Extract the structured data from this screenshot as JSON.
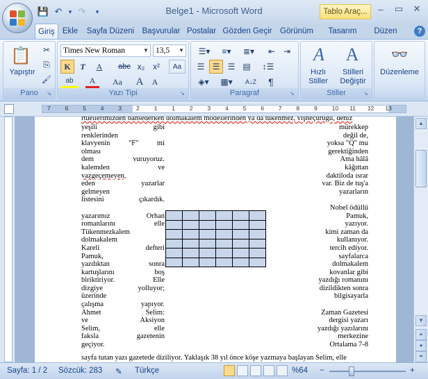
{
  "app": {
    "title": "Belge1 - Microsoft Word",
    "context_tab_title": "Tablo Araç...",
    "qat": {
      "save": "💾",
      "undo": "↶",
      "undo_dd": "▾",
      "redo": "↷",
      "custom": "▾"
    },
    "win": {
      "min": "–",
      "max": "▭",
      "close": "✕"
    }
  },
  "tabs": [
    "Giriş",
    "Ekle",
    "Sayfa Düzeni",
    "Başvurular",
    "Postalar",
    "Gözden Geçir",
    "Görünüm",
    "Tasarım",
    "Düzen"
  ],
  "ribbon": {
    "clipboard": {
      "label": "Pano",
      "paste": "Yapıştır",
      "cut": "✂",
      "copy": "⎘",
      "format": "🖌"
    },
    "font": {
      "label": "Yazı Tipi",
      "name": "Times New Roman",
      "size": "13,5",
      "bold": "K",
      "italic": "T",
      "underline": "A",
      "strike": "abc",
      "sub": "x₂",
      "sup": "x²",
      "clear": "Aa",
      "grow": "A",
      "shrink": "A",
      "case": "Aa",
      "highlight": "ab",
      "color": "A",
      "change": "Aa"
    },
    "paragraph": {
      "label": "Paragraf",
      "pilcrow": "¶",
      "sort": "A↓Z"
    },
    "styles": {
      "label": "Stiller",
      "quick": "Hızlı\nStiller",
      "change": "Stilleri\nDeğiştir"
    },
    "editing": {
      "label": "Düzenleme"
    }
  },
  "ruler": {
    "numbers": [
      "7",
      "6",
      "5",
      "4",
      "3",
      "2",
      "1",
      "1",
      "2",
      "3",
      "4",
      "5",
      "6",
      "7",
      "8",
      "9",
      "10",
      "11",
      "12",
      "13"
    ]
  },
  "document": {
    "first_line": "rtüellerimizden bahsederken dolmakalem modellerinden ya da tükenmez, vişneçürüğü, deniz",
    "left": [
      "yeşili gibi",
      "renklerinden",
      "klavyenin \"F\" mi",
      "olması",
      "dem vuruyoruz.",
      "kalemden ve",
      "vazgeçemeyen,",
      "eden yazarlar",
      "gelmeyen",
      "listesini çıkardık.",
      "",
      "yazarımız Orhan",
      "romanlarını elle",
      "Tükenmezkalem",
      "dolmakalem",
      "Kareli defteri",
      "Pamuk,",
      "yazdıktan sonra",
      "kartuşlarını boş",
      "biriktiriyor. Elle",
      "dizgiye yolluyor;",
      "üzerinde",
      "çalışma yapıyor.",
      "Ahmet Selim:",
      "ve Aksiyon",
      "Selim, elle",
      "faksla gazetenin",
      "geçiyor."
    ],
    "right": [
      "mürekkep",
      "değil de,",
      "yoksa \"Q\" mu",
      "gerektiğinden",
      "Ama hâlâ",
      "kâğıttan",
      "daktiloda ısrar",
      "var. Biz de tuş'a",
      "yazarların",
      "",
      "Nobel ödüllü",
      "Pamuk,",
      "yazıyor.",
      "kimi zaman da",
      "kullanıyor.",
      "tercih ediyor.",
      "sayfalarca",
      "dolmakalem",
      "kovanlar gibi",
      "yazdığı romanını",
      "dizildikten sonra",
      "bilgisayarla",
      "",
      "Zaman Gazetesi",
      "dergisi yazarı",
      "yazdığı yazılarını",
      "merkezine",
      "Ortalama 7-8"
    ],
    "last_line": "sayfa tutan yazı gazetede diziliyor. Yaklaşık 38 yıl önce köşe yazmaya başlayan Selim, elle"
  },
  "status": {
    "page": "Sayfa: 1 / 2",
    "words": "Sözcük: 283",
    "lang": "Türkçe",
    "zoom": "%64",
    "zoom_minus": "−",
    "zoom_plus": "+"
  }
}
